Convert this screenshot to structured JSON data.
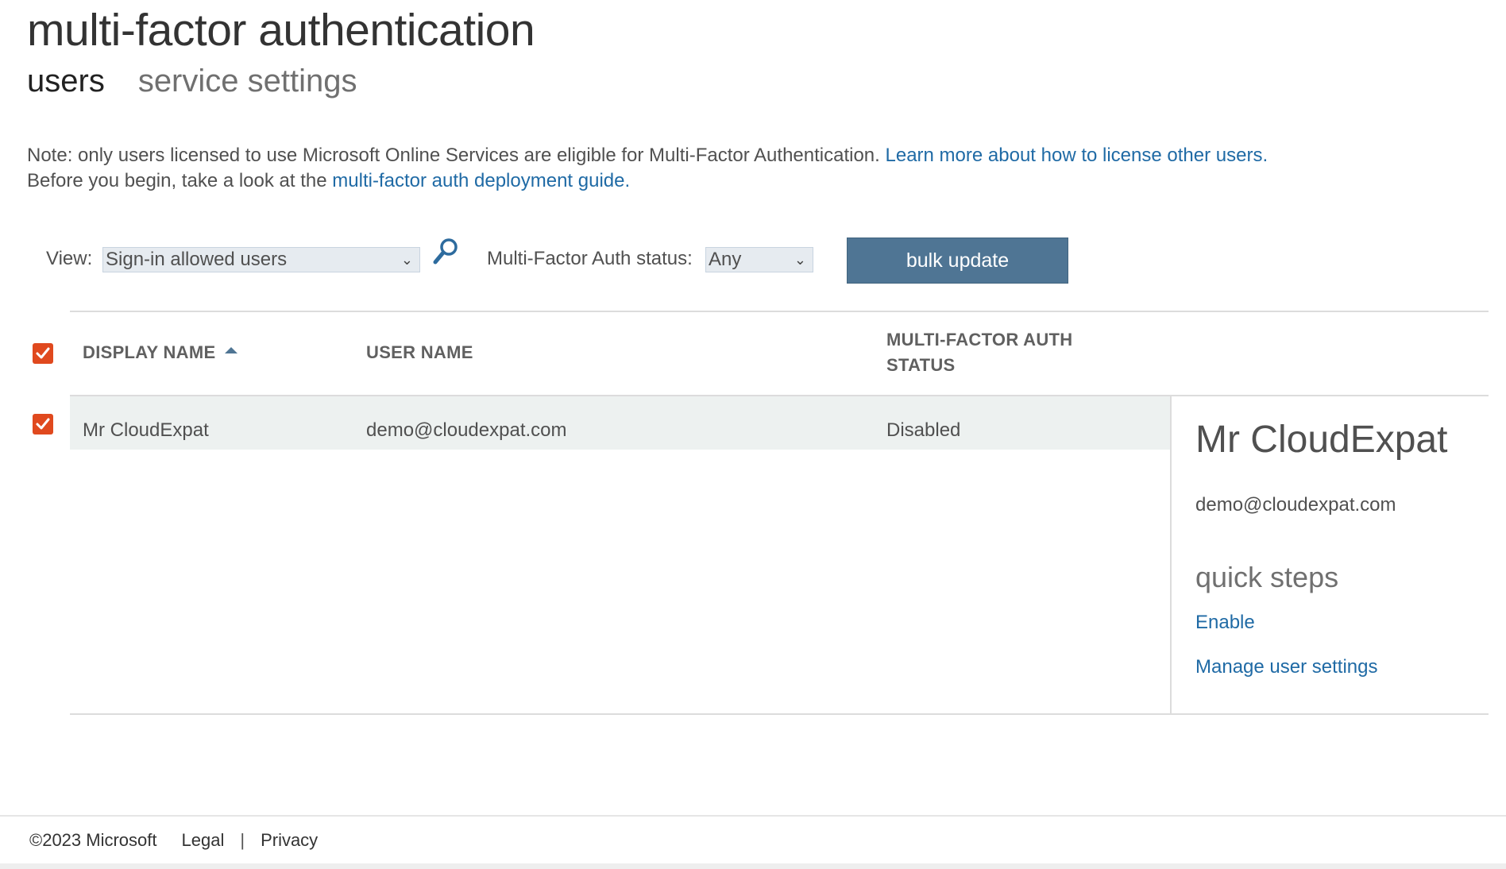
{
  "page": {
    "title": "multi-factor authentication",
    "tabs": [
      {
        "label": "users",
        "active": true
      },
      {
        "label": "service settings",
        "active": false
      }
    ]
  },
  "note": {
    "line1_text": "Note: only users licensed to use Microsoft Online Services are eligible for Multi-Factor Authentication.",
    "line1_link": "Learn more about how to license other users.",
    "line2_text": "Before you begin, take a look at the",
    "line2_link": "multi-factor auth deployment guide."
  },
  "filters": {
    "view_label": "View:",
    "view_value": "Sign-in allowed users",
    "status_label": "Multi-Factor Auth status:",
    "status_value": "Any",
    "bulk_update_label": "bulk update",
    "search_icon": "search-icon"
  },
  "table": {
    "columns": {
      "display_name": "DISPLAY NAME",
      "user_name": "USER NAME",
      "mfa_status_line1": "MULTI-FACTOR AUTH",
      "mfa_status_line2": "STATUS"
    },
    "rows": [
      {
        "display_name": "Mr CloudExpat",
        "user_name": "demo@cloudexpat.com",
        "mfa_status": "Disabled",
        "selected": true
      }
    ]
  },
  "detail": {
    "name": "Mr CloudExpat",
    "email": "demo@cloudexpat.com",
    "quick_steps_heading": "quick steps",
    "enable_link": "Enable",
    "manage_link": "Manage user settings"
  },
  "footer": {
    "copyright": "©2023 Microsoft",
    "legal": "Legal",
    "separator": "|",
    "privacy": "Privacy"
  },
  "colors": {
    "accent_checkbox": "#e0491e",
    "button_bg": "#4f7594",
    "link": "#1f6aa5",
    "row_highlight": "#edf1f0"
  }
}
